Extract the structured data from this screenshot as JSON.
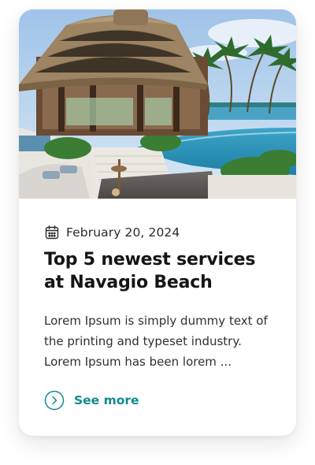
{
  "card": {
    "date": "February 20, 2024",
    "title": "Top 5 newest services at Navagio Beach",
    "excerpt": "Lorem Ipsum is simply dummy text of the printing and typeset industry. Lorem Ipsum has been lorem ...",
    "see_more_label": "See more",
    "icons": {
      "date": "calendar-icon",
      "see_more": "chevron-right-circle-icon"
    },
    "colors": {
      "accent": "#128a8f",
      "title": "#151515",
      "text": "#303030"
    }
  }
}
